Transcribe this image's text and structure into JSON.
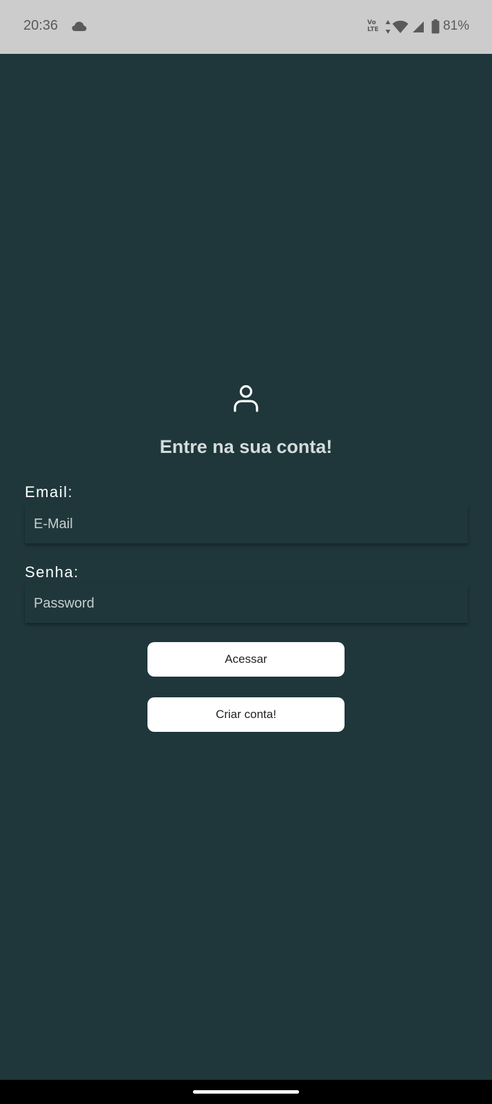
{
  "status_bar": {
    "time": "20:36",
    "volte_top": "Vo",
    "volte_bottom": "LTE",
    "battery_percent": "81%",
    "icons": [
      "cloud-icon",
      "volte-icon",
      "data-arrows-icon",
      "wifi-icon",
      "signal-icon",
      "battery-icon"
    ]
  },
  "login": {
    "title": "Entre na sua conta!",
    "email_label": "Email:",
    "email_placeholder": "E-Mail",
    "email_value": "",
    "password_label": "Senha:",
    "password_placeholder": "Password",
    "password_value": "",
    "login_button": "Acessar",
    "signup_button": "Criar conta!"
  },
  "colors": {
    "background": "#1f373b",
    "status_bar": "#cccccc",
    "button": "#ffffff",
    "title": "#d5dcdc",
    "nav_bar": "#000000"
  }
}
